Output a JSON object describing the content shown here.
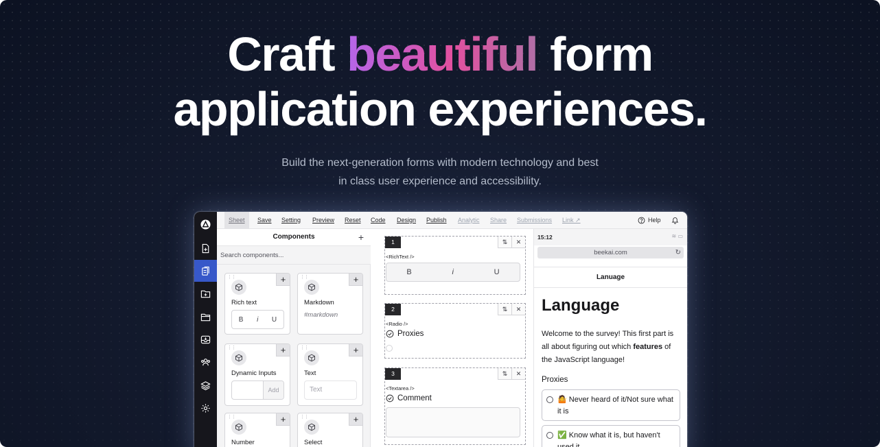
{
  "hero": {
    "line1_pre": "Craft ",
    "line1_accent": "beautiful",
    "line1_post": " form",
    "line2": "application experiences.",
    "subtitle_line1": "Build the next-generation forms with modern technology and best",
    "subtitle_line2": "in class user experience and accessibility."
  },
  "colors": {
    "background": "#131a2d",
    "accent_gradient_start": "#b566ea",
    "accent_gradient_mid": "#e1509f",
    "rail_active": "#3758c9"
  },
  "app": {
    "rail_icons": [
      "logo-icon",
      "file-plus-icon",
      "clipboard-icon",
      "folder-plus-icon",
      "folder-icon",
      "inbox-icon",
      "users-icon",
      "layers-icon",
      "gear-icon"
    ],
    "menu": {
      "sheet": "Sheet",
      "save": "Save",
      "setting": "Setting",
      "preview": "Preview",
      "reset": "Reset",
      "code": "Code",
      "design": "Design",
      "publish": "Publish",
      "analytic": "Analytic",
      "share": "Share",
      "submissions": "Submissions",
      "link": "Link",
      "help": "Help"
    },
    "components": {
      "title": "Components",
      "add": "+",
      "search_placeholder": "Search components...",
      "cards": {
        "rich_text": {
          "title": "Rich text",
          "b": "B",
          "i": "i",
          "u": "U"
        },
        "markdown": {
          "title": "Markdown",
          "preview": "#markdown"
        },
        "dynamic_inputs": {
          "title": "Dynamic Inputs",
          "add": "Add"
        },
        "text": {
          "title": "Text",
          "placeholder": "Text"
        },
        "number": {
          "title": "Number"
        },
        "select": {
          "title": "Select"
        }
      }
    },
    "canvas": {
      "blocks": [
        {
          "num": "1",
          "tag": "<RichText />",
          "b": "B",
          "i": "i",
          "u": "U"
        },
        {
          "num": "2",
          "tag": "<Radio />",
          "label": "Proxies"
        },
        {
          "num": "3",
          "tag": "<Textarea />",
          "label": "Comment"
        }
      ]
    },
    "preview": {
      "time": "15:12",
      "url": "beekai.com",
      "header": "Lanuage",
      "heading": "Language",
      "desc_pre": "Welcome to the survey! This first part is all about figuring out which ",
      "desc_bold": "features",
      "desc_post": " of the JavaScript language!",
      "question": "Proxies",
      "option1": "🤷 Never heard of it/Not sure what it is",
      "option2": "✅ Know what it is, but haven't used it"
    }
  }
}
